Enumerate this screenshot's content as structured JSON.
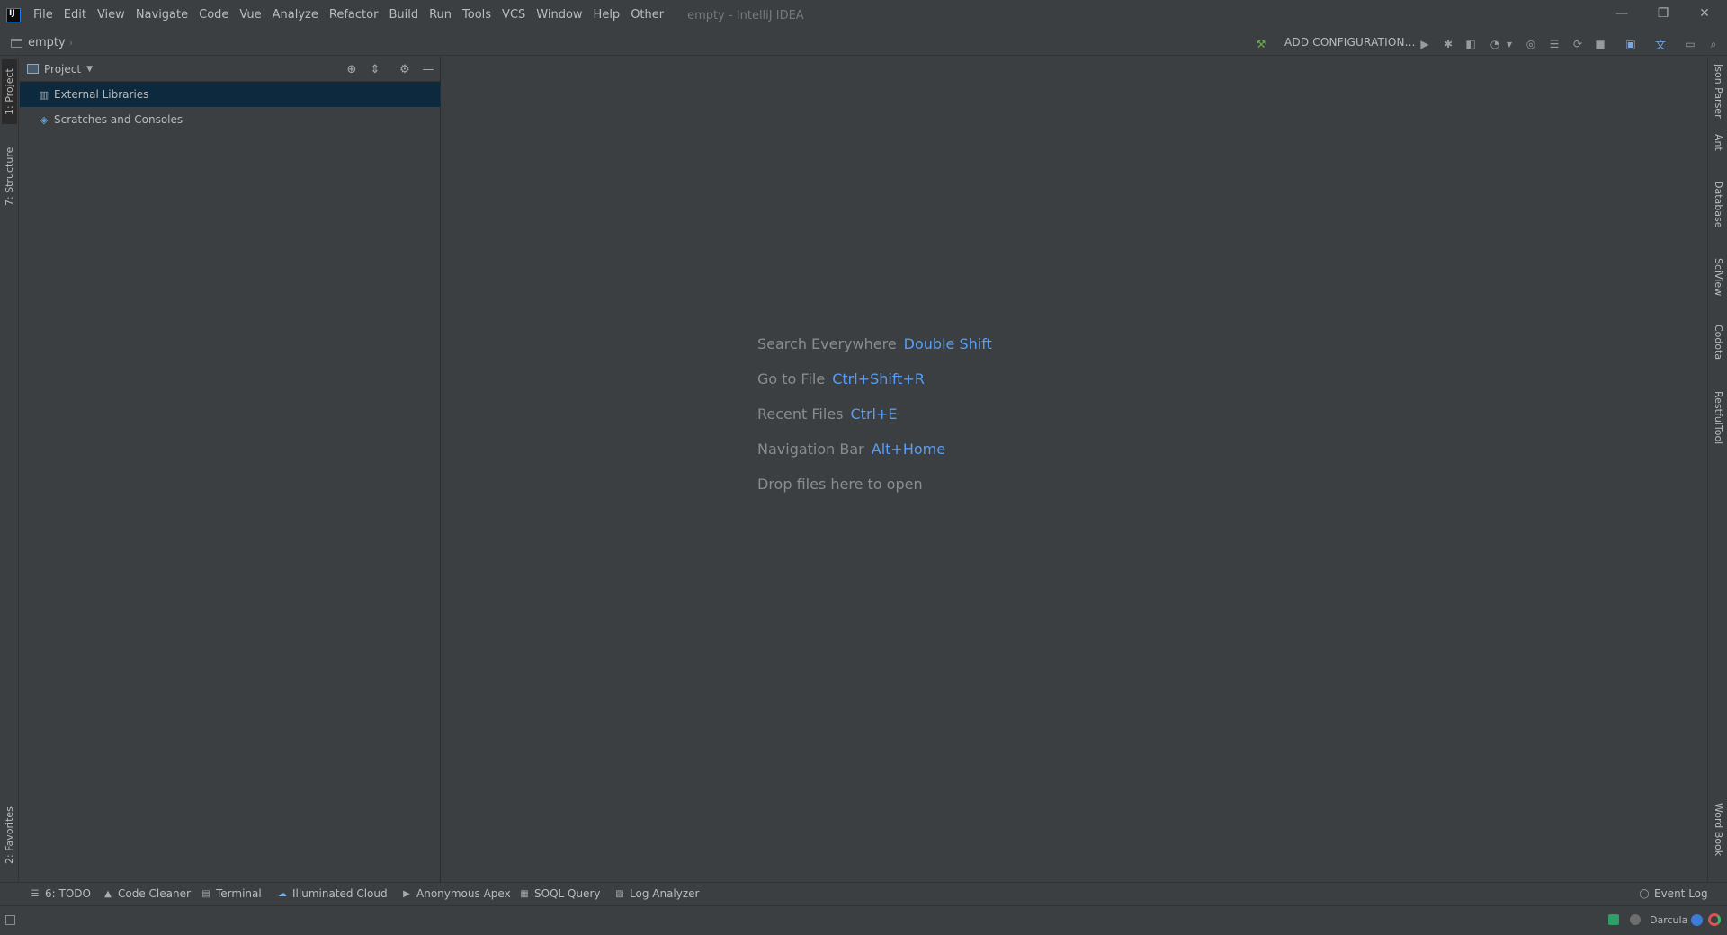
{
  "window": {
    "title": "empty - IntelliJ IDEA",
    "controls": {
      "minimize": "—",
      "restore": "❐",
      "close": "✕"
    }
  },
  "menu": [
    "File",
    "Edit",
    "View",
    "Navigate",
    "Code",
    "Vue",
    "Analyze",
    "Refactor",
    "Build",
    "Run",
    "Tools",
    "VCS",
    "Window",
    "Help",
    "Other"
  ],
  "navbar": {
    "breadcrumb": "empty",
    "add_configuration": "ADD CONFIGURATION..."
  },
  "left_stripe": {
    "project": "1: Project",
    "structure": "7: Structure",
    "favorites": "2: Favorites"
  },
  "right_stripe": [
    "Json Parser",
    "Ant",
    "Database",
    "SciView",
    "Codota",
    "RestfulTool",
    "Word Book"
  ],
  "project_panel": {
    "title": "Project",
    "items": [
      {
        "label": "External Libraries",
        "icon": "library-icon",
        "selected": true
      },
      {
        "label": "Scratches and Consoles",
        "icon": "scratches-icon",
        "selected": false
      }
    ]
  },
  "editor_hints": [
    {
      "label": "Search Everywhere",
      "shortcut": "Double Shift"
    },
    {
      "label": "Go to File",
      "shortcut": "Ctrl+Shift+R"
    },
    {
      "label": "Recent Files",
      "shortcut": "Ctrl+E"
    },
    {
      "label": "Navigation Bar",
      "shortcut": "Alt+Home"
    },
    {
      "label": "Drop files here to open",
      "shortcut": ""
    }
  ],
  "bottom_tabs": [
    {
      "label": "6: TODO",
      "icon": "todo-icon"
    },
    {
      "label": "Code Cleaner",
      "icon": "cleaner-icon"
    },
    {
      "label": "Terminal",
      "icon": "terminal-icon"
    },
    {
      "label": "Illuminated Cloud",
      "icon": "cloud-icon"
    },
    {
      "label": "Anonymous Apex",
      "icon": "apex-icon"
    },
    {
      "label": "SOQL Query",
      "icon": "query-icon"
    },
    {
      "label": "Log Analyzer",
      "icon": "log-icon"
    }
  ],
  "event_log": "Event Log",
  "status": {
    "theme": "Darcula"
  },
  "colors": {
    "background": "#3c3f41",
    "selection": "#0d293e",
    "shortcut": "#589df6",
    "hint": "#8c8c8c"
  }
}
